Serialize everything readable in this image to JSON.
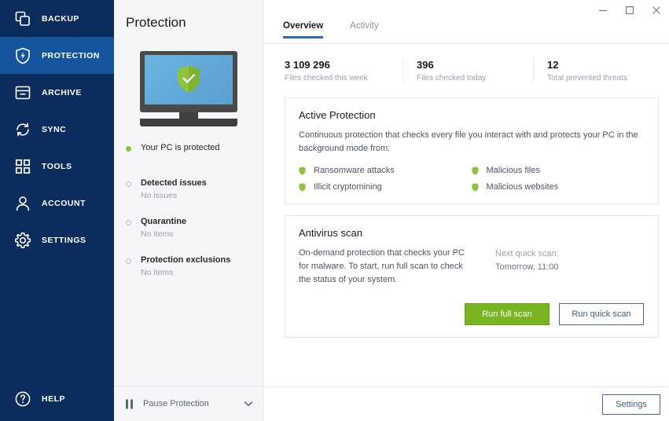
{
  "colors": {
    "sidebar_bg": "#0a2d5e",
    "sidebar_active": "#15559e",
    "accent_blue": "#2a6cb5",
    "green": "#79b520",
    "green_shield": "#8cc43c",
    "screen_blue": "#5ba0d0",
    "panel_bg": "#f4f6f9"
  },
  "sidebar": {
    "items": [
      {
        "label": "BACKUP",
        "icon": "backup-copies-icon",
        "active": false
      },
      {
        "label": "PROTECTION",
        "icon": "shield-bolt-icon",
        "active": true
      },
      {
        "label": "ARCHIVE",
        "icon": "archive-box-icon",
        "active": false
      },
      {
        "label": "SYNC",
        "icon": "sync-arrows-icon",
        "active": false
      },
      {
        "label": "TOOLS",
        "icon": "grid-squares-icon",
        "active": false
      },
      {
        "label": "ACCOUNT",
        "icon": "person-icon",
        "active": false
      },
      {
        "label": "SETTINGS",
        "icon": "gear-icon",
        "active": false
      }
    ],
    "help": {
      "label": "HELP",
      "icon": "question-circle-icon"
    }
  },
  "middle": {
    "title": "Protection",
    "illustration": "monitor-with-shield-illustration",
    "protected_status": "Your PC is protected",
    "status_items": [
      {
        "title": "Detected issues",
        "value": "No issues"
      },
      {
        "title": "Quarantine",
        "value": "No items"
      },
      {
        "title": "Protection exclusions",
        "value": "No items"
      }
    ],
    "pause": {
      "label": "Pause Protection",
      "icon": "pause-icon",
      "chevron": "chevron-down-icon"
    }
  },
  "titlebar": {
    "minimize": "minimize-icon",
    "maximize": "maximize-icon",
    "close": "close-icon"
  },
  "tabs": [
    {
      "label": "Overview",
      "active": true
    },
    {
      "label": "Activity",
      "active": false
    }
  ],
  "stats": [
    {
      "value": "3 109 296",
      "label": "Files checked this week"
    },
    {
      "value": "396",
      "label": "Files checked today"
    },
    {
      "value": "12",
      "label": "Total prevented threats"
    }
  ],
  "active_protection": {
    "title": "Active Protection",
    "description": "Continuous protection that checks every file you interact with and protects your PC in the background mode from:",
    "features": [
      "Ransomware attacks",
      "Malicious files",
      "Illicit cryptomining",
      "Malicious websites"
    ]
  },
  "antivirus": {
    "title": "Antivirus scan",
    "description": "On-demand protection that checks your PC for malware. To start, run full scan to check the status of your system.",
    "next_scan_label": "Next quick scan:",
    "next_scan_value": "Tomorrow, 11:00",
    "run_full_scan": "Run full scan",
    "run_quick_scan": "Run quick scan"
  },
  "footer": {
    "settings": "Settings"
  }
}
